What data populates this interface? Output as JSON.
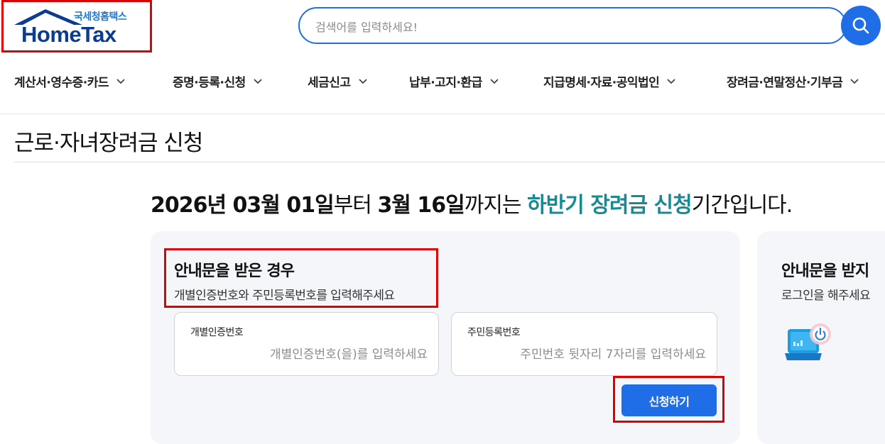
{
  "header": {
    "logo_sub": "국세청홈택스",
    "logo_main": "HomeTax",
    "search_placeholder": "검색어를 입력하세요!"
  },
  "nav": {
    "items": [
      {
        "label": "계산서·영수증·카드"
      },
      {
        "label": "증명·등록·신청"
      },
      {
        "label": "세금신고"
      },
      {
        "label": "납부·고지·환급"
      },
      {
        "label": "지급명세·자료·공익법인"
      },
      {
        "label": "장려금·연말정산·기부금"
      }
    ]
  },
  "page": {
    "title": "근로·자녀장려금 신청"
  },
  "period": {
    "start": "2026년 03월 01일",
    "mid1": "부터 ",
    "end": "3월 16일",
    "mid2": "까지는 ",
    "highlight": "하반기 장려금 신청",
    "tail": "기간입니다."
  },
  "left_card": {
    "title": "안내문을 받은 경우",
    "desc": "개별인증번호와 주민등록번호를 입력해주세요",
    "field1_label": "개별인증번호",
    "field1_placeholder": "개별인증번호(을)를 입력하세요",
    "field2_label": "주민등록번호",
    "field2_placeholder": "주민번호 뒷자리 7자리를 입력하세요",
    "submit_label": "신청하기"
  },
  "right_card": {
    "title": "안내문을 받지",
    "desc": "로그인을 해주세요"
  },
  "colors": {
    "primary": "#1f6ee8",
    "accent": "#178a94",
    "highlight_border": "#e10000"
  }
}
